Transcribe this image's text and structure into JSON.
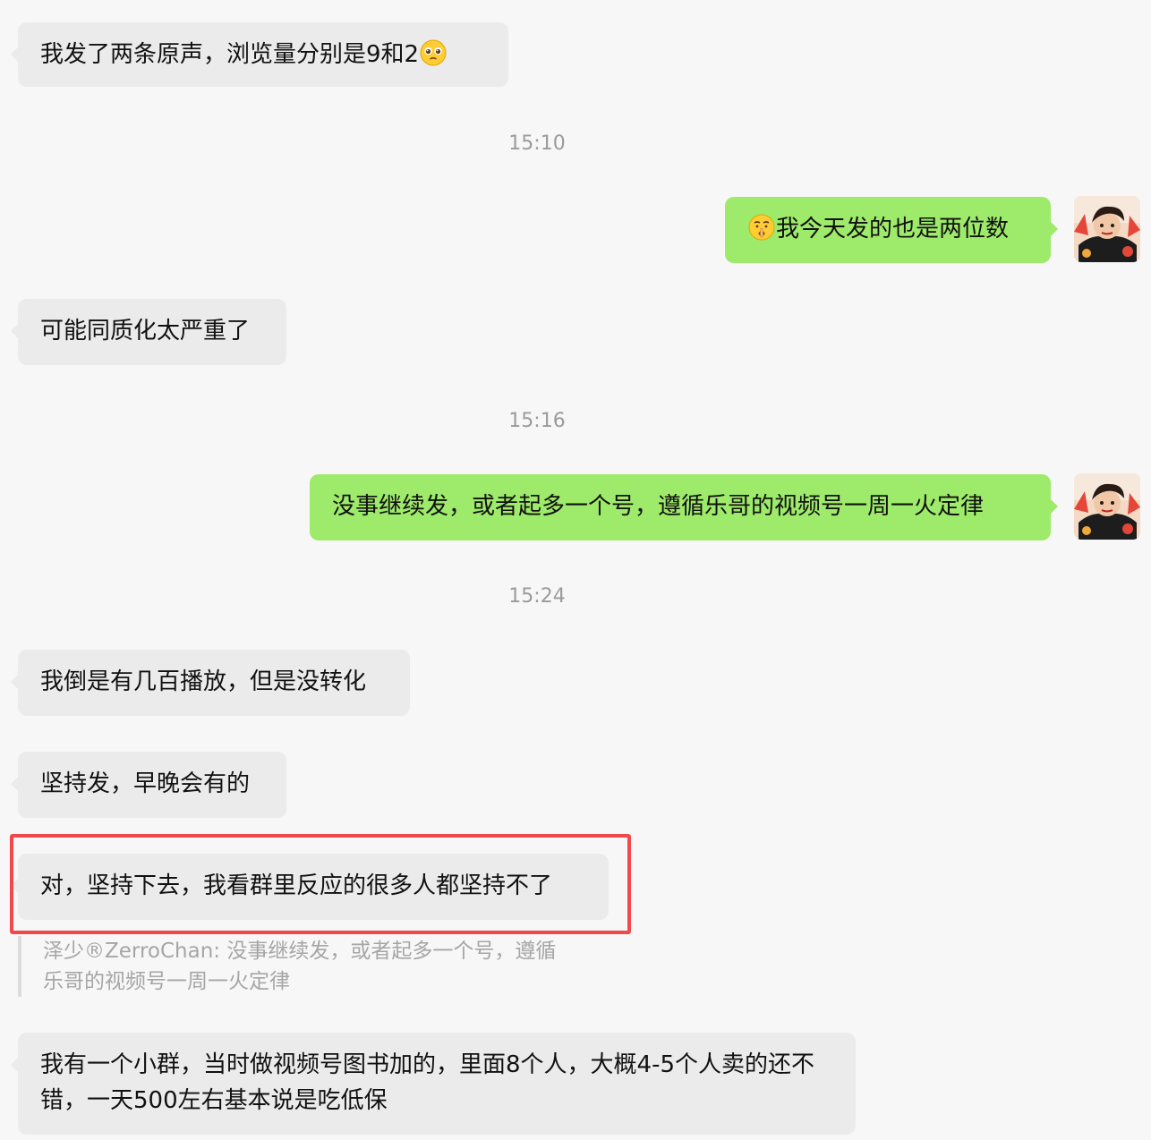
{
  "messages": {
    "m1": "我发了两条原声，浏览量分别是9和2",
    "t1": "15:10",
    "m2": "我今天发的也是两位数",
    "m3": "可能同质化太严重了",
    "t2": "15:16",
    "m4": "没事继续发，或者起多一个号，遵循乐哥的视频号一周一火定律",
    "t3": "15:24",
    "m5": "我倒是有几百播放，但是没转化",
    "m6": "坚持发，早晚会有的",
    "m7": "对，坚持下去，我看群里反应的很多人都坚持不了",
    "quote": "泽少®ZerroChan: 没事继续发，或者起多一个号，遵循乐哥的视频号一周一火定律",
    "m8": "我有一个小群，当时做视频号图书加的，里面8个人，大概4-5个人卖的还不错，一天500左右基本说是吃低保"
  },
  "icons": {
    "emoji_m1": "pleading-face-emoji",
    "emoji_m2": "shushing-face-emoji",
    "avatar": "user-avatar"
  },
  "colors": {
    "incoming_bubble": "#ebebeb",
    "outgoing_bubble": "#9eea6a",
    "highlight_border": "#f0484c",
    "timestamp": "#9b9b9b",
    "quote_text": "#a6a6a6"
  }
}
